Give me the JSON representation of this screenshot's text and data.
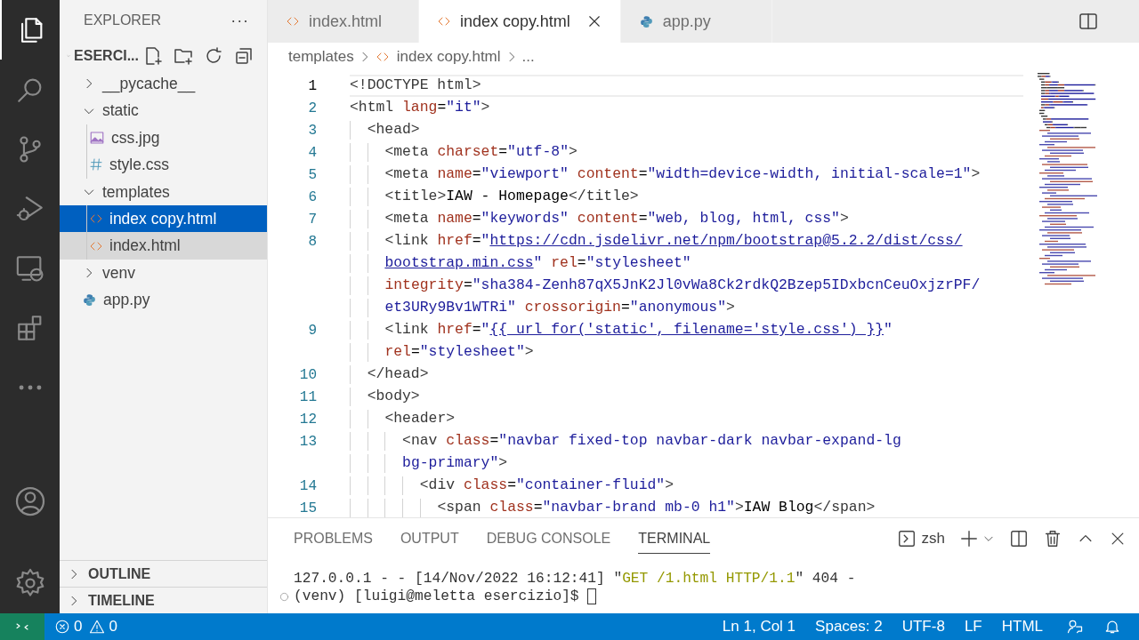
{
  "activity_bar": {
    "items": [
      {
        "selected": true
      },
      {
        "selected": false
      },
      {
        "selected": false
      },
      {
        "selected": false
      },
      {
        "selected": false
      },
      {
        "selected": false
      },
      {
        "selected": false
      }
    ]
  },
  "sidebar": {
    "title": "EXPLORER",
    "more": "···",
    "root": {
      "label": "ESERCI...",
      "expanded": true
    },
    "tree": [
      {
        "label": "__pycache__",
        "kind": "folder",
        "expanded": false,
        "selected": false,
        "hovered": false
      },
      {
        "label": "static",
        "kind": "folder",
        "expanded": true,
        "selected": false,
        "hovered": false,
        "children": [
          {
            "label": "css.jpg",
            "kind": "image",
            "selected": false,
            "hovered": false
          },
          {
            "label": "style.css",
            "kind": "css",
            "selected": false,
            "hovered": false
          }
        ]
      },
      {
        "label": "templates",
        "kind": "folder",
        "expanded": true,
        "selected": false,
        "hovered": false,
        "children": [
          {
            "label": "index copy.html",
            "kind": "html",
            "selected": true,
            "hovered": false
          },
          {
            "label": "index.html",
            "kind": "html",
            "selected": false,
            "hovered": true
          }
        ]
      },
      {
        "label": "venv",
        "kind": "folder",
        "expanded": false,
        "selected": false,
        "hovered": false
      },
      {
        "label": "app.py",
        "kind": "python",
        "selected": false,
        "hovered": false
      }
    ],
    "sections": [
      {
        "label": "OUTLINE",
        "expanded": false
      },
      {
        "label": "TIMELINE",
        "expanded": false
      }
    ]
  },
  "tabs": [
    {
      "label": "index.html",
      "kind": "html",
      "selected": false
    },
    {
      "label": "index copy.html",
      "kind": "html",
      "selected": true
    },
    {
      "label": "app.py",
      "kind": "python",
      "selected": false
    }
  ],
  "breadcrumb": [
    {
      "label": "templates",
      "kind": "folder"
    },
    {
      "label": "index copy.html",
      "kind": "html"
    },
    {
      "label": "...",
      "kind": "more"
    }
  ],
  "code": [
    {
      "number": "1",
      "current": true,
      "rows": [
        {
          "segments": [
            {
              "text": "<!DOCTYPE html>",
              "kind": "tag"
            }
          ]
        }
      ]
    },
    {
      "number": "2",
      "current": false,
      "rows": [
        {
          "segments": [
            {
              "text": "<html",
              "kind": "tag"
            },
            {
              "text": " lang",
              "kind": "attr"
            },
            {
              "text": "=",
              "kind": "eq"
            },
            {
              "text": "\"it\"",
              "kind": "str"
            },
            {
              "text": ">",
              "kind": "tag"
            }
          ]
        }
      ],
      "children": [
        {
          "number": "3",
          "current": false,
          "rows": [
            {
              "segments": [
                {
                  "text": "<head>",
                  "kind": "tag"
                }
              ]
            }
          ],
          "children": [
            {
              "number": "4",
              "current": false,
              "rows": [
                {
                  "segments": [
                    {
                      "text": "<meta",
                      "kind": "tag"
                    },
                    {
                      "text": " charset",
                      "kind": "attr"
                    },
                    {
                      "text": "=",
                      "kind": "eq"
                    },
                    {
                      "text": "\"utf-8\"",
                      "kind": "str"
                    },
                    {
                      "text": ">",
                      "kind": "tag"
                    }
                  ]
                }
              ]
            },
            {
              "number": "5",
              "current": false,
              "rows": [
                {
                  "segments": [
                    {
                      "text": "<meta",
                      "kind": "tag"
                    },
                    {
                      "text": " name",
                      "kind": "attr"
                    },
                    {
                      "text": "=",
                      "kind": "eq"
                    },
                    {
                      "text": "\"viewport\"",
                      "kind": "str"
                    },
                    {
                      "text": " content",
                      "kind": "attr"
                    },
                    {
                      "text": "=",
                      "kind": "eq"
                    },
                    {
                      "text": "\"width=device-width, initial-scale=1\"",
                      "kind": "str"
                    },
                    {
                      "text": ">",
                      "kind": "tag"
                    }
                  ]
                }
              ]
            },
            {
              "number": "6",
              "current": false,
              "rows": [
                {
                  "segments": [
                    {
                      "text": "<title>",
                      "kind": "tag"
                    },
                    {
                      "text": "IAW - Homepage",
                      "kind": "text"
                    },
                    {
                      "text": "</title>",
                      "kind": "tag"
                    }
                  ]
                }
              ]
            },
            {
              "number": "7",
              "current": false,
              "rows": [
                {
                  "segments": [
                    {
                      "text": "<meta",
                      "kind": "tag"
                    },
                    {
                      "text": " name",
                      "kind": "attr"
                    },
                    {
                      "text": "=",
                      "kind": "eq"
                    },
                    {
                      "text": "\"keywords\"",
                      "kind": "str"
                    },
                    {
                      "text": " content",
                      "kind": "attr"
                    },
                    {
                      "text": "=",
                      "kind": "eq"
                    },
                    {
                      "text": "\"web, blog, html, css\"",
                      "kind": "str"
                    },
                    {
                      "text": ">",
                      "kind": "tag"
                    }
                  ]
                }
              ]
            },
            {
              "number": "8",
              "current": false,
              "rows": [
                {
                  "segments": [
                    {
                      "text": "<link",
                      "kind": "tag"
                    },
                    {
                      "text": " href",
                      "kind": "attr"
                    },
                    {
                      "text": "=",
                      "kind": "eq"
                    },
                    {
                      "text": "\"",
                      "kind": "str"
                    },
                    {
                      "text": "https://cdn.jsdelivr.net/npm/bootstrap@5.2.2/dist/css/",
                      "kind": "link"
                    }
                  ]
                },
                {
                  "segments": [
                    {
                      "text": "bootstrap.min.css",
                      "kind": "link"
                    },
                    {
                      "text": "\"",
                      "kind": "str"
                    },
                    {
                      "text": " rel",
                      "kind": "attr"
                    },
                    {
                      "text": "=",
                      "kind": "eq"
                    },
                    {
                      "text": "\"stylesheet\"",
                      "kind": "str"
                    }
                  ]
                },
                {
                  "segments": [
                    {
                      "text": "integrity",
                      "kind": "attr"
                    },
                    {
                      "text": "=",
                      "kind": "eq"
                    },
                    {
                      "text": "\"sha384-Zenh87qX5JnK2Jl0vWa8Ck2rdkQ2Bzep5IDxbcnCeuOxjzrPF/",
                      "kind": "str"
                    }
                  ]
                },
                {
                  "segments": [
                    {
                      "text": "et3URy9Bv1WTRi\"",
                      "kind": "str"
                    },
                    {
                      "text": " crossorigin",
                      "kind": "attr"
                    },
                    {
                      "text": "=",
                      "kind": "eq"
                    },
                    {
                      "text": "\"anonymous\"",
                      "kind": "str"
                    },
                    {
                      "text": ">",
                      "kind": "tag"
                    }
                  ]
                }
              ]
            },
            {
              "number": "9",
              "current": false,
              "rows": [
                {
                  "segments": [
                    {
                      "text": "<link",
                      "kind": "tag"
                    },
                    {
                      "text": " href",
                      "kind": "attr"
                    },
                    {
                      "text": "=",
                      "kind": "eq"
                    },
                    {
                      "text": "\"",
                      "kind": "str"
                    },
                    {
                      "text": "{{ url_for('static', filename='style.css') }}",
                      "kind": "link"
                    },
                    {
                      "text": "\"",
                      "kind": "str"
                    }
                  ]
                },
                {
                  "segments": [
                    {
                      "text": "rel",
                      "kind": "attr"
                    },
                    {
                      "text": "=",
                      "kind": "eq"
                    },
                    {
                      "text": "\"stylesheet\"",
                      "kind": "str"
                    },
                    {
                      "text": ">",
                      "kind": "tag"
                    }
                  ]
                }
              ]
            }
          ]
        },
        {
          "number": "10",
          "current": false,
          "rows": [
            {
              "segments": [
                {
                  "text": "</head>",
                  "kind": "tag"
                }
              ]
            }
          ]
        },
        {
          "number": "11",
          "current": false,
          "rows": [
            {
              "segments": [
                {
                  "text": "<body>",
                  "kind": "tag"
                }
              ]
            }
          ],
          "children": [
            {
              "number": "12",
              "current": false,
              "rows": [
                {
                  "segments": [
                    {
                      "text": "<header>",
                      "kind": "tag"
                    }
                  ]
                }
              ],
              "children": [
                {
                  "number": "13",
                  "current": false,
                  "rows": [
                    {
                      "segments": [
                        {
                          "text": "<nav",
                          "kind": "tag"
                        },
                        {
                          "text": " class",
                          "kind": "attr"
                        },
                        {
                          "text": "=",
                          "kind": "eq"
                        },
                        {
                          "text": "\"navbar fixed-top navbar-dark navbar-expand-lg",
                          "kind": "str"
                        }
                      ]
                    },
                    {
                      "segments": [
                        {
                          "text": "bg-primary\"",
                          "kind": "str"
                        },
                        {
                          "text": ">",
                          "kind": "tag"
                        }
                      ]
                    }
                  ],
                  "children": [
                    {
                      "number": "14",
                      "current": false,
                      "rows": [
                        {
                          "segments": [
                            {
                              "text": "<div",
                              "kind": "tag"
                            },
                            {
                              "text": " class",
                              "kind": "attr"
                            },
                            {
                              "text": "=",
                              "kind": "eq"
                            },
                            {
                              "text": "\"container-fluid\"",
                              "kind": "str"
                            },
                            {
                              "text": ">",
                              "kind": "tag"
                            }
                          ]
                        }
                      ],
                      "children": [
                        {
                          "number": "15",
                          "current": false,
                          "rows": [
                            {
                              "segments": [
                                {
                                  "text": "<span",
                                  "kind": "tag"
                                },
                                {
                                  "text": " class",
                                  "kind": "attr"
                                },
                                {
                                  "text": "=",
                                  "kind": "eq"
                                },
                                {
                                  "text": "\"navbar-brand mb-0 h1\"",
                                  "kind": "str"
                                },
                                {
                                  "text": ">",
                                  "kind": "tag"
                                },
                                {
                                  "text": "IAW Blog",
                                  "kind": "text"
                                },
                                {
                                  "text": "</span>",
                                  "kind": "tag"
                                }
                              ]
                            }
                          ]
                        }
                      ]
                    }
                  ]
                }
              ]
            }
          ]
        }
      ]
    }
  ],
  "panel": {
    "tabs": [
      {
        "label": "PROBLEMS",
        "selected": false
      },
      {
        "label": "OUTPUT",
        "selected": false
      },
      {
        "label": "DEBUG CONSOLE",
        "selected": false
      },
      {
        "label": "TERMINAL",
        "selected": true
      }
    ],
    "shell": "zsh",
    "terminal": [
      {
        "prompt": false,
        "segments": [
          {
            "text": "127.0.0.1 - - [14/Nov/2022 16:12:41] \"",
            "kind": "out"
          },
          {
            "text": "GET /1.html HTTP/1.1",
            "kind": "request"
          },
          {
            "text": "\" 404 -",
            "kind": "out"
          }
        ]
      },
      {
        "prompt": true,
        "segments": [
          {
            "text": "(venv) [luigi@meletta esercizio]$ ",
            "kind": "out"
          }
        ]
      }
    ]
  },
  "status_bar": {
    "errors": "0",
    "warnings": "0",
    "items": [
      "Ln 1, Col 1",
      "Spaces: 2",
      "UTF-8",
      "LF",
      "HTML"
    ]
  }
}
